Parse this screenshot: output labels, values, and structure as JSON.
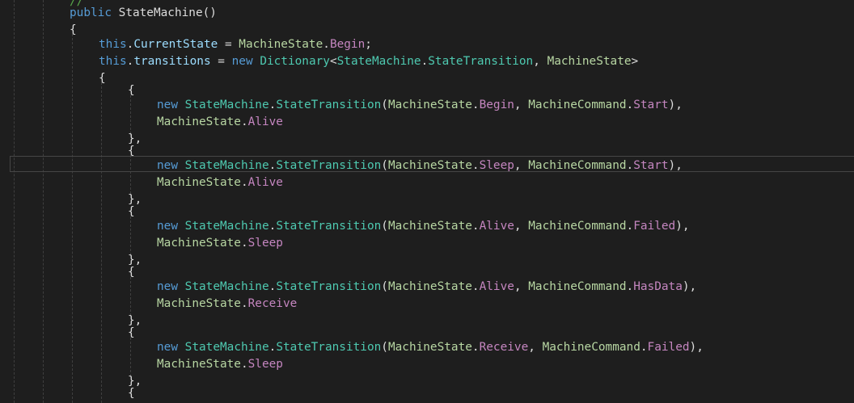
{
  "theme": {
    "background": "#1e1e1e",
    "colors": {
      "kw": "#569cd6",
      "type": "#4ec9b0",
      "prop": "#dcdcdc",
      "field": "#dcdcdc",
      "enum": "#b8d7a3",
      "enumval": "#c586c0",
      "member": "#9cdcfe",
      "punct": "#dcdcdc",
      "method": "#dcdcdc",
      "comment": "#57a64a"
    }
  },
  "code": {
    "lines": [
      {
        "indent": 2,
        "tokens": [
          [
            "comment",
            "//"
          ]
        ]
      },
      {
        "indent": 2,
        "tokens": [
          [
            "kw",
            "public"
          ],
          [
            "punct",
            " "
          ],
          [
            "method",
            "StateMachine"
          ],
          [
            "punct",
            "()"
          ]
        ]
      },
      {
        "indent": 2,
        "tokens": [
          [
            "punct",
            "{"
          ]
        ]
      },
      {
        "indent": 3,
        "tokens": [
          [
            "kw",
            "this"
          ],
          [
            "punct",
            "."
          ],
          [
            "member",
            "CurrentState"
          ],
          [
            "punct",
            " = "
          ],
          [
            "enum",
            "MachineState"
          ],
          [
            "punct",
            "."
          ],
          [
            "enumval",
            "Begin"
          ],
          [
            "punct",
            ";"
          ]
        ]
      },
      {
        "indent": 3,
        "tokens": [
          [
            "kw",
            "this"
          ],
          [
            "punct",
            "."
          ],
          [
            "member",
            "transitions"
          ],
          [
            "punct",
            " = "
          ],
          [
            "kw",
            "new"
          ],
          [
            "punct",
            " "
          ],
          [
            "type",
            "Dictionary"
          ],
          [
            "punct",
            "<"
          ],
          [
            "type",
            "StateMachine"
          ],
          [
            "punct",
            "."
          ],
          [
            "type",
            "StateTransition"
          ],
          [
            "punct",
            ", "
          ],
          [
            "enum",
            "MachineState"
          ],
          [
            "punct",
            ">"
          ]
        ]
      },
      {
        "indent": 3,
        "tokens": [
          [
            "punct",
            "{"
          ]
        ]
      },
      {
        "indent": 4,
        "tokens": [
          [
            "punct",
            "{"
          ]
        ]
      },
      {
        "indent": 5,
        "tokens": [
          [
            "kw",
            "new"
          ],
          [
            "punct",
            " "
          ],
          [
            "type",
            "StateMachine"
          ],
          [
            "punct",
            "."
          ],
          [
            "type",
            "StateTransition"
          ],
          [
            "punct",
            "("
          ],
          [
            "enum",
            "MachineState"
          ],
          [
            "punct",
            "."
          ],
          [
            "enumval",
            "Begin"
          ],
          [
            "punct",
            ", "
          ],
          [
            "enum",
            "MachineCommand"
          ],
          [
            "punct",
            "."
          ],
          [
            "enumval",
            "Start"
          ],
          [
            "punct",
            "),"
          ]
        ]
      },
      {
        "indent": 5,
        "tokens": [
          [
            "enum",
            "MachineState"
          ],
          [
            "punct",
            "."
          ],
          [
            "enumval",
            "Alive"
          ]
        ]
      },
      {
        "indent": 4,
        "tokens": [
          [
            "punct",
            "},"
          ]
        ]
      },
      {
        "indent": 4,
        "tokens": [
          [
            "punct",
            "{"
          ]
        ]
      },
      {
        "indent": 5,
        "tokens": [
          [
            "kw",
            "new"
          ],
          [
            "punct",
            " "
          ],
          [
            "type",
            "StateMachine"
          ],
          [
            "punct",
            "."
          ],
          [
            "type",
            "StateTransition"
          ],
          [
            "punct",
            "("
          ],
          [
            "enum",
            "MachineState"
          ],
          [
            "punct",
            "."
          ],
          [
            "enumval",
            "Sleep"
          ],
          [
            "punct",
            ", "
          ],
          [
            "enum",
            "MachineCommand"
          ],
          [
            "punct",
            "."
          ],
          [
            "enumval",
            "Start"
          ],
          [
            "punct",
            "),"
          ]
        ],
        "current": true
      },
      {
        "indent": 5,
        "tokens": [
          [
            "enum",
            "MachineState"
          ],
          [
            "punct",
            "."
          ],
          [
            "enumval",
            "Alive"
          ]
        ]
      },
      {
        "indent": 4,
        "tokens": [
          [
            "punct",
            "},"
          ]
        ]
      },
      {
        "indent": 4,
        "tokens": [
          [
            "punct",
            "{"
          ]
        ]
      },
      {
        "indent": 5,
        "tokens": [
          [
            "kw",
            "new"
          ],
          [
            "punct",
            " "
          ],
          [
            "type",
            "StateMachine"
          ],
          [
            "punct",
            "."
          ],
          [
            "type",
            "StateTransition"
          ],
          [
            "punct",
            "("
          ],
          [
            "enum",
            "MachineState"
          ],
          [
            "punct",
            "."
          ],
          [
            "enumval",
            "Alive"
          ],
          [
            "punct",
            ", "
          ],
          [
            "enum",
            "MachineCommand"
          ],
          [
            "punct",
            "."
          ],
          [
            "enumval",
            "Failed"
          ],
          [
            "punct",
            "),"
          ]
        ]
      },
      {
        "indent": 5,
        "tokens": [
          [
            "enum",
            "MachineState"
          ],
          [
            "punct",
            "."
          ],
          [
            "enumval",
            "Sleep"
          ]
        ]
      },
      {
        "indent": 4,
        "tokens": [
          [
            "punct",
            "},"
          ]
        ]
      },
      {
        "indent": 4,
        "tokens": [
          [
            "punct",
            "{"
          ]
        ]
      },
      {
        "indent": 5,
        "tokens": [
          [
            "kw",
            "new"
          ],
          [
            "punct",
            " "
          ],
          [
            "type",
            "StateMachine"
          ],
          [
            "punct",
            "."
          ],
          [
            "type",
            "StateTransition"
          ],
          [
            "punct",
            "("
          ],
          [
            "enum",
            "MachineState"
          ],
          [
            "punct",
            "."
          ],
          [
            "enumval",
            "Alive"
          ],
          [
            "punct",
            ", "
          ],
          [
            "enum",
            "MachineCommand"
          ],
          [
            "punct",
            "."
          ],
          [
            "enumval",
            "HasData"
          ],
          [
            "punct",
            "),"
          ]
        ]
      },
      {
        "indent": 5,
        "tokens": [
          [
            "enum",
            "MachineState"
          ],
          [
            "punct",
            "."
          ],
          [
            "enumval",
            "Receive"
          ]
        ]
      },
      {
        "indent": 4,
        "tokens": [
          [
            "punct",
            "},"
          ]
        ]
      },
      {
        "indent": 4,
        "tokens": [
          [
            "punct",
            "{"
          ]
        ]
      },
      {
        "indent": 5,
        "tokens": [
          [
            "kw",
            "new"
          ],
          [
            "punct",
            " "
          ],
          [
            "type",
            "StateMachine"
          ],
          [
            "punct",
            "."
          ],
          [
            "type",
            "StateTransition"
          ],
          [
            "punct",
            "("
          ],
          [
            "enum",
            "MachineState"
          ],
          [
            "punct",
            "."
          ],
          [
            "enumval",
            "Receive"
          ],
          [
            "punct",
            ", "
          ],
          [
            "enum",
            "MachineCommand"
          ],
          [
            "punct",
            "."
          ],
          [
            "enumval",
            "Failed"
          ],
          [
            "punct",
            "),"
          ]
        ]
      },
      {
        "indent": 5,
        "tokens": [
          [
            "enum",
            "MachineState"
          ],
          [
            "punct",
            "."
          ],
          [
            "enumval",
            "Sleep"
          ]
        ]
      },
      {
        "indent": 4,
        "tokens": [
          [
            "punct",
            "},"
          ]
        ]
      },
      {
        "indent": 4,
        "tokens": [
          [
            "punct",
            "{"
          ]
        ]
      }
    ]
  }
}
